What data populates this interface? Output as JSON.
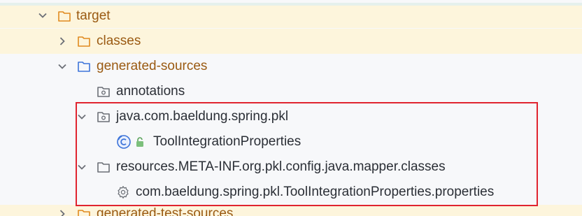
{
  "accent": "#e0242f",
  "tree": {
    "target": {
      "label": "target",
      "icon": "folder-icon",
      "expanded": true
    },
    "classes": {
      "label": "classes",
      "icon": "folder-icon",
      "expanded": false
    },
    "generated_sources": {
      "label": "generated-sources",
      "icon": "folder-blue-icon",
      "expanded": true
    },
    "annotations": {
      "label": "annotations",
      "icon": "package-folder-icon"
    },
    "pkg_java": {
      "label": "java.com.baeldung.spring.pkl",
      "icon": "package-folder-icon",
      "expanded": true
    },
    "tool_props_class": {
      "label": "ToolIntegrationProperties",
      "icon": "class-icon",
      "lock": "lock-icon"
    },
    "pkg_resources": {
      "label": "resources.META-INF.org.pkl.config.java.mapper.classes",
      "icon": "folder-icon",
      "expanded": true
    },
    "properties_file": {
      "label": "com.baeldung.spring.pkl.ToolIntegrationProperties.properties",
      "icon": "gear-icon"
    },
    "generated_test_sources": {
      "label": "generated-test-sources",
      "icon": "folder-icon",
      "expanded": false
    }
  }
}
